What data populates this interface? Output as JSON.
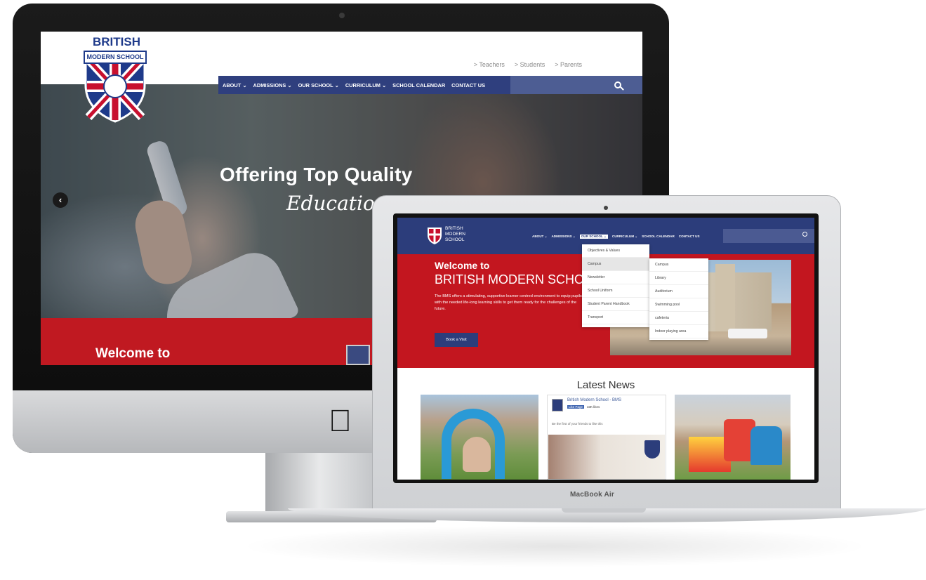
{
  "imac": {
    "logo": {
      "line1": "BRITISH",
      "line2": "MODERN SCHOOL"
    },
    "top_links": [
      "> Teachers",
      "> Students",
      "> Parents"
    ],
    "nav": [
      "ABOUT ⌄",
      "ADMISSIONS ⌄",
      "OUR SCHOOL ⌄",
      "CURRICULUM ⌄",
      "SCHOOL CALENDAR",
      "CONTACT US"
    ],
    "hero": {
      "title": "Offering Top Quality",
      "subtitle": "Educatio",
      "prev_arrow": "‹"
    },
    "welcome": "Welcome to",
    "icons": {
      "search": "search-icon",
      "apple": "apple-logo-icon"
    }
  },
  "macbook": {
    "label": "MacBook Air",
    "brand": {
      "line1": "BRITISH",
      "line2": "MODERN",
      "line3": "SCHOOL"
    },
    "nav": [
      "ABOUT ⌄",
      "ADMISSIONS ⌄",
      "OUR SCHOOL ⌄",
      "CURRICULUM ⌄",
      "SCHOOL CALENDAR",
      "CONTACT US"
    ],
    "dropdown": [
      "Objectives & Values",
      "Campus",
      "Newsletter",
      "School Uniform",
      "Student Parent Handbook",
      "Transport"
    ],
    "submenu": [
      "Campus",
      "Library",
      "Auditorium",
      "Swimming pool",
      "cafeteria",
      "Indoor playing area"
    ],
    "hero": {
      "welcome": "Welcome to",
      "school": "BRITISH MODERN SCHO",
      "description": "The BMS offers a stimulating, supportive learner centred environment to equip pupils with the needed life-long learning skills to get them ready for the challenges of the future.",
      "button": "Book a Visit"
    },
    "news": {
      "title": "Latest News",
      "fb_name": "British Modern School - BMS",
      "fb_like": "Like Page",
      "fb_count": "33K likes",
      "fb_first": "Be the first of your friends to like this"
    }
  },
  "colors": {
    "navy": "#2c3d7b",
    "red": "#c3161f"
  }
}
